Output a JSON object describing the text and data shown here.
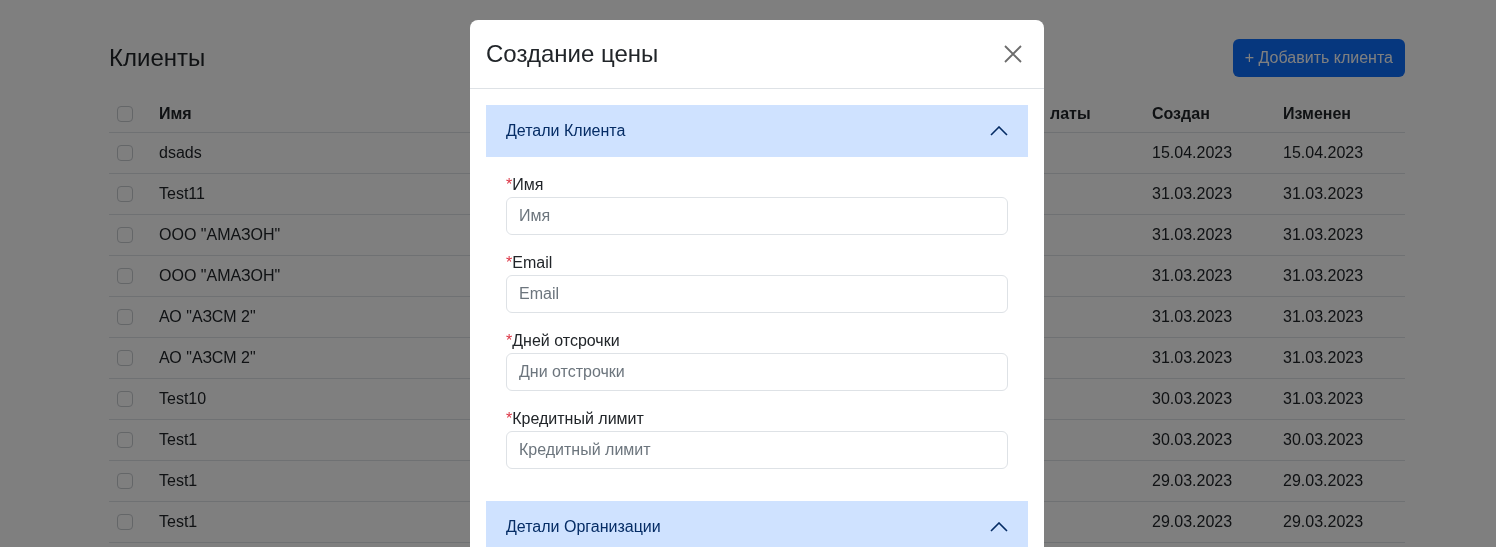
{
  "page": {
    "title": "Клиенты",
    "add_button": "+ Добавить клиента"
  },
  "table": {
    "header_checkbox": {
      "checked": false
    },
    "columns": [
      "Имя",
      "латы",
      "Создан",
      "Изменен"
    ],
    "rows": [
      {
        "checked": false,
        "name": "dsads",
        "created": "15.04.2023",
        "changed": "15.04.2023"
      },
      {
        "checked": false,
        "name": "Test11",
        "created": "31.03.2023",
        "changed": "31.03.2023"
      },
      {
        "checked": false,
        "name": "ООО \"АМАЗОН\"",
        "created": "31.03.2023",
        "changed": "31.03.2023"
      },
      {
        "checked": false,
        "name": "ООО \"АМАЗОН\"",
        "created": "31.03.2023",
        "changed": "31.03.2023"
      },
      {
        "checked": false,
        "name": "АО \"АЗСМ 2\"",
        "created": "31.03.2023",
        "changed": "31.03.2023"
      },
      {
        "checked": false,
        "name": "АО \"АЗСМ 2\"",
        "created": "31.03.2023",
        "changed": "31.03.2023"
      },
      {
        "checked": false,
        "name": "Test10",
        "created": "30.03.2023",
        "changed": "31.03.2023"
      },
      {
        "checked": false,
        "name": "Test1",
        "created": "30.03.2023",
        "changed": "30.03.2023"
      },
      {
        "checked": false,
        "name": "Test1",
        "created": "29.03.2023",
        "changed": "29.03.2023"
      },
      {
        "checked": false,
        "name": "Test1",
        "created": "29.03.2023",
        "changed": "29.03.2023"
      }
    ]
  },
  "modal": {
    "title": "Создание цены",
    "sections": [
      {
        "title": "Детали Клиента",
        "expanded": true,
        "fields": [
          {
            "required_mark": "*",
            "label": "Имя",
            "placeholder": "Имя"
          },
          {
            "required_mark": "*",
            "label": "Email",
            "placeholder": "Email"
          },
          {
            "required_mark": "*",
            "label": "Дней отсрочки",
            "placeholder": "Дни отстрочки"
          },
          {
            "required_mark": "*",
            "label": "Кредитный лимит",
            "placeholder": "Кредитный лимит"
          }
        ]
      },
      {
        "title": "Детали Организации",
        "expanded": true
      }
    ]
  }
}
